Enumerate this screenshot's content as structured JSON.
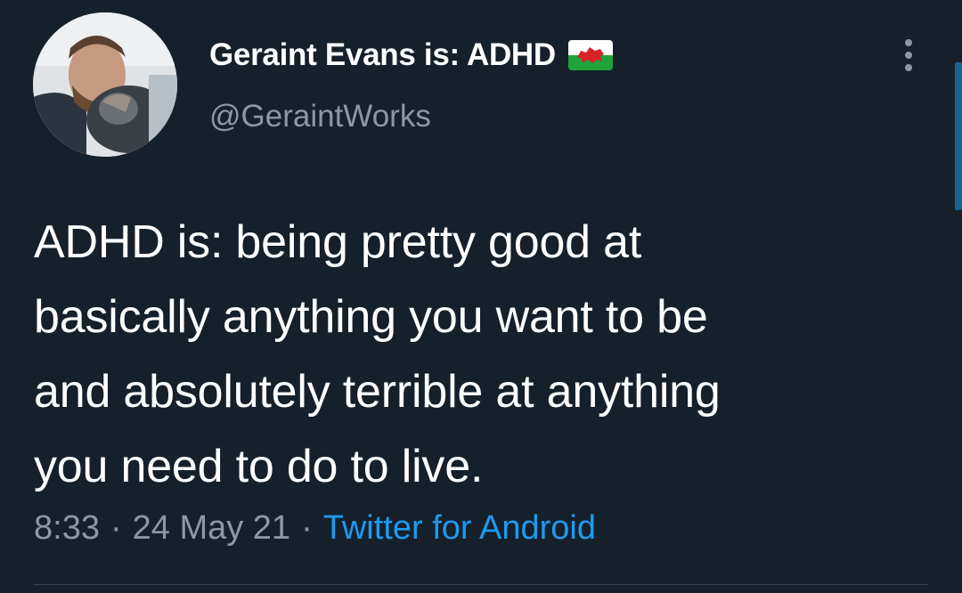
{
  "author": {
    "display_name": "Geraint Evans is: ADHD",
    "handle": "@GeraintWorks",
    "flag_icon": "wales-flag-icon"
  },
  "tweet": {
    "lines": [
      "ADHD is: being pretty good at",
      "basically anything you want to be",
      "and absolutely terrible at anything",
      "you need to do to live."
    ]
  },
  "meta": {
    "time": "8:33",
    "date": "24 May 21",
    "separator": "·",
    "source": "Twitter for Android"
  },
  "colors": {
    "background": "#15202b",
    "text": "#ffffff",
    "muted": "#8b98a5",
    "accent": "#1d9bf0"
  }
}
